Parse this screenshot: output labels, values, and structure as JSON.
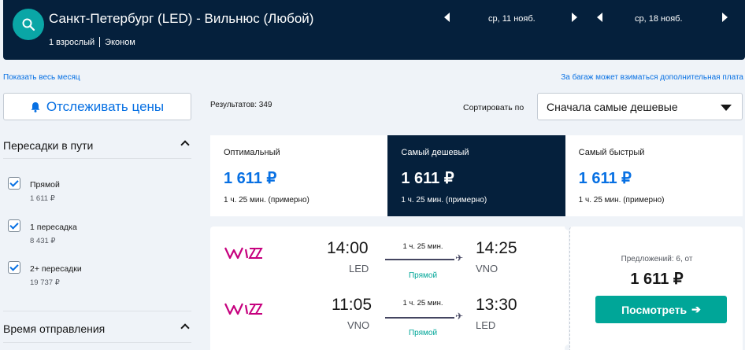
{
  "header": {
    "route": "Санкт-Петербург (LED) - Вильнюс (Любой)",
    "passengers": "1 взрослый",
    "cabin": "Эконом",
    "depart_date": "ср, 11 нояб.",
    "return_date": "ср, 18 нояб."
  },
  "links": {
    "show_month": "Показать весь месяц",
    "baggage_note": "За багаж может взиматься дополнительная плата"
  },
  "sidebar": {
    "track_prices": "Отслеживать цены",
    "stops_title": "Пересадки в пути",
    "stops": [
      {
        "label": "Прямой",
        "price": "1 611 ₽",
        "checked": true
      },
      {
        "label": "1 пересадка",
        "price": "8 431 ₽",
        "checked": true
      },
      {
        "label": "2+ пересадки",
        "price": "19 737 ₽",
        "checked": true
      }
    ],
    "departure_title": "Время отправления"
  },
  "results": {
    "count_text": "Результатов: 349",
    "sort_label": "Сортировать по",
    "sort_value": "Сначала самые дешевые"
  },
  "tabs": [
    {
      "name": "Оптимальный",
      "price": "1 611 ₽",
      "duration": "1 ч. 25 мин. (примерно)",
      "active": false
    },
    {
      "name": "Самый дешевый",
      "price": "1 611 ₽",
      "duration": "1 ч. 25 мин. (примерно)",
      "active": true
    },
    {
      "name": "Самый быстрый",
      "price": "1 611 ₽",
      "duration": "1 ч. 25 мин. (примерно)",
      "active": false
    }
  ],
  "result": {
    "airline_logo": "wizz",
    "legs": [
      {
        "dep_time": "14:00",
        "dep_code": "LED",
        "duration": "1 ч. 25 мин.",
        "stops": "Прямой",
        "arr_time": "14:25",
        "arr_code": "VNO"
      },
      {
        "dep_time": "11:05",
        "dep_code": "VNO",
        "duration": "1 ч. 25 мин.",
        "stops": "Прямой",
        "arr_time": "13:30",
        "arr_code": "LED"
      }
    ],
    "offers": "Предложений: 6, от",
    "price": "1 611 ₽",
    "view_button": "Посмотреть"
  },
  "colors": {
    "header_bg": "#05203c",
    "accent_blue": "#0770e3",
    "teal": "#00a698",
    "wizz_purple": "#c6007e"
  }
}
